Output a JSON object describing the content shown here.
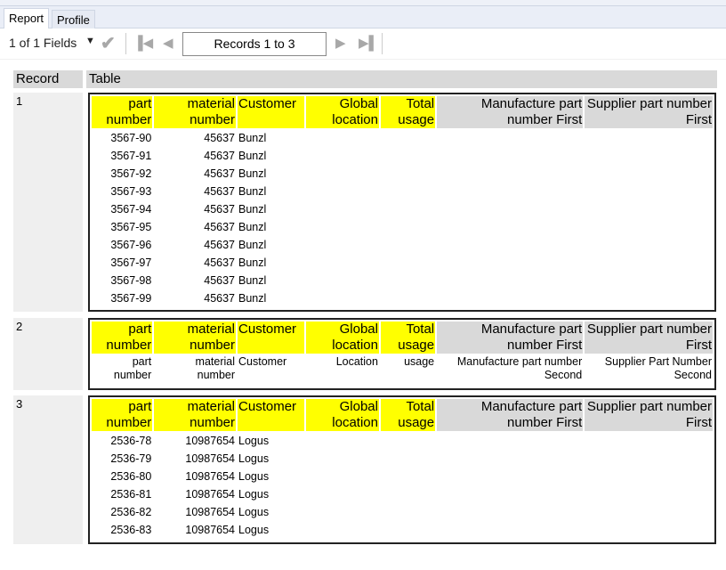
{
  "tabs": [
    {
      "label": "Report",
      "active": true
    },
    {
      "label": "Profile",
      "active": false
    }
  ],
  "toolbar": {
    "fields_label": "1 of 1 Fields",
    "records_label": "Records 1 to 3"
  },
  "report": {
    "headers": {
      "record": "Record",
      "table": "Table"
    },
    "columns": [
      "part number",
      "material number",
      "Customer",
      "Global location",
      "Total usage",
      "Manufacture part number First",
      "Supplier part number First"
    ],
    "records": [
      {
        "id": "1",
        "rows": [
          [
            "3567-90",
            "45637",
            "Bunzl"
          ],
          [
            "3567-91",
            "45637",
            "Bunzl"
          ],
          [
            "3567-92",
            "45637",
            "Bunzl"
          ],
          [
            "3567-93",
            "45637",
            "Bunzl"
          ],
          [
            "3567-94",
            "45637",
            "Bunzl"
          ],
          [
            "3567-95",
            "45637",
            "Bunzl"
          ],
          [
            "3567-96",
            "45637",
            "Bunzl"
          ],
          [
            "3567-97",
            "45637",
            "Bunzl"
          ],
          [
            "3567-98",
            "45637",
            "Bunzl"
          ],
          [
            "3567-99",
            "45637",
            "Bunzl"
          ]
        ]
      },
      {
        "id": "2",
        "rows": [
          [
            "part number",
            "material number",
            "Customer",
            "Location",
            "usage",
            "Manufacture part number Second",
            "Supplier Part Number Second"
          ]
        ]
      },
      {
        "id": "3",
        "rows": [
          [
            "2536-78",
            "10987654",
            "Logus"
          ],
          [
            "2536-79",
            "10987654",
            "Logus"
          ],
          [
            "2536-80",
            "10987654",
            "Logus"
          ],
          [
            "2536-81",
            "10987654",
            "Logus"
          ],
          [
            "2536-82",
            "10987654",
            "Logus"
          ],
          [
            "2536-83",
            "10987654",
            "Logus"
          ]
        ]
      }
    ]
  }
}
